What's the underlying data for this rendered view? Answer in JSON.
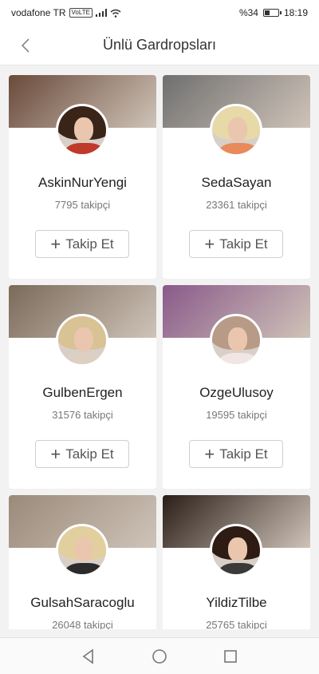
{
  "status_bar": {
    "carrier": "vodafone TR",
    "volte": "VoLTE",
    "battery": "%34",
    "time": "18:19"
  },
  "header": {
    "title": "Ünlü Gardropsları"
  },
  "follow_label": "Takip Et",
  "cards": [
    {
      "name": "AskinNurYengi",
      "followers": "7795 takipçi",
      "cover": "#6a4a3a",
      "hair": "#3a2418",
      "outfit": "#c0392b"
    },
    {
      "name": "SedaSayan",
      "followers": "23361 takipçi",
      "cover": "#6f6f6f",
      "hair": "#e7d9a8",
      "outfit": "#e88a5a"
    },
    {
      "name": "GulbenErgen",
      "followers": "31576 takipçi",
      "cover": "#7a6a5a",
      "hair": "#d9c294",
      "outfit": "#ddd0c2"
    },
    {
      "name": "OzgeUlusoy",
      "followers": "19595 takipçi",
      "cover": "#8a5a8a",
      "hair": "#b79b86",
      "outfit": "#f1e6e3"
    },
    {
      "name": "GulsahSaracoglu",
      "followers": "26048 takipçi",
      "cover": "#9a8a7a",
      "hair": "#e2cf9e",
      "outfit": "#2b2b2b"
    },
    {
      "name": "YildizTilbe",
      "followers": "25765 takipçi",
      "cover": "#2a1e18",
      "hair": "#2e1c14",
      "outfit": "#3a3a3a"
    }
  ]
}
